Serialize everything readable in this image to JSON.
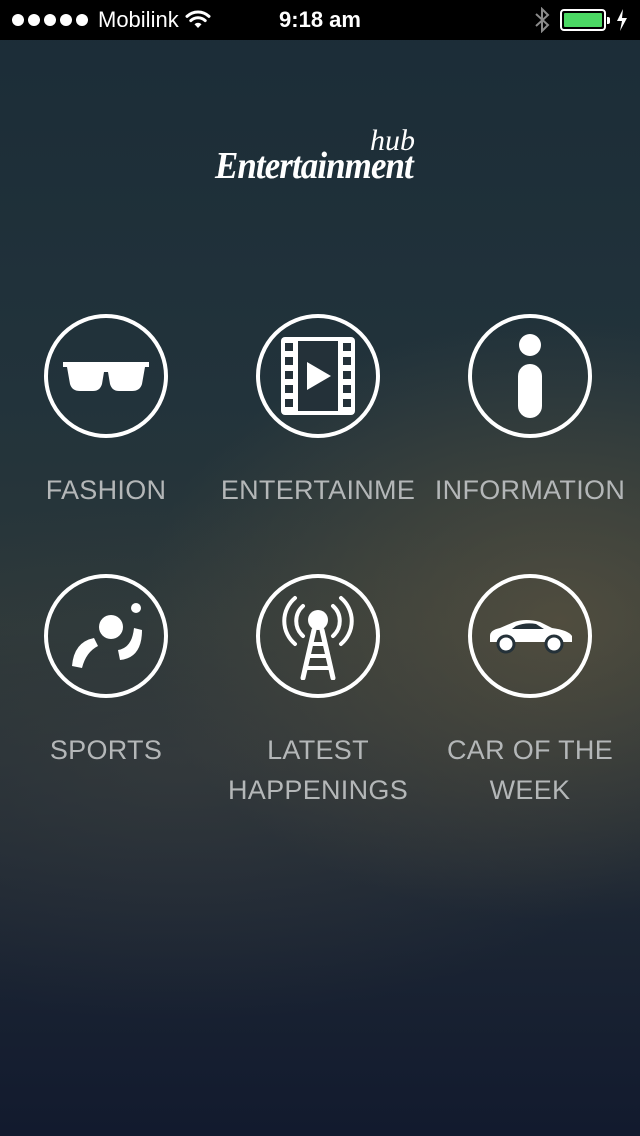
{
  "status_bar": {
    "carrier": "Mobilink",
    "time": "9:18 am",
    "battery_color": "#4cd964"
  },
  "logo": {
    "small": "hub",
    "main": "Entertainment"
  },
  "menu": [
    {
      "label": "FASHION",
      "icon": "sunglasses-icon"
    },
    {
      "label": "ENTERTAINME",
      "icon": "film-play-icon"
    },
    {
      "label": "INFORMATION",
      "icon": "info-icon"
    },
    {
      "label": "SPORTS",
      "icon": "sports-icon"
    },
    {
      "label_line1": "LATEST",
      "label_line2": "HAPPENINGS",
      "icon": "broadcast-tower-icon"
    },
    {
      "label_line1": "CAR OF THE",
      "label_line2": "WEEK",
      "icon": "car-icon"
    }
  ]
}
